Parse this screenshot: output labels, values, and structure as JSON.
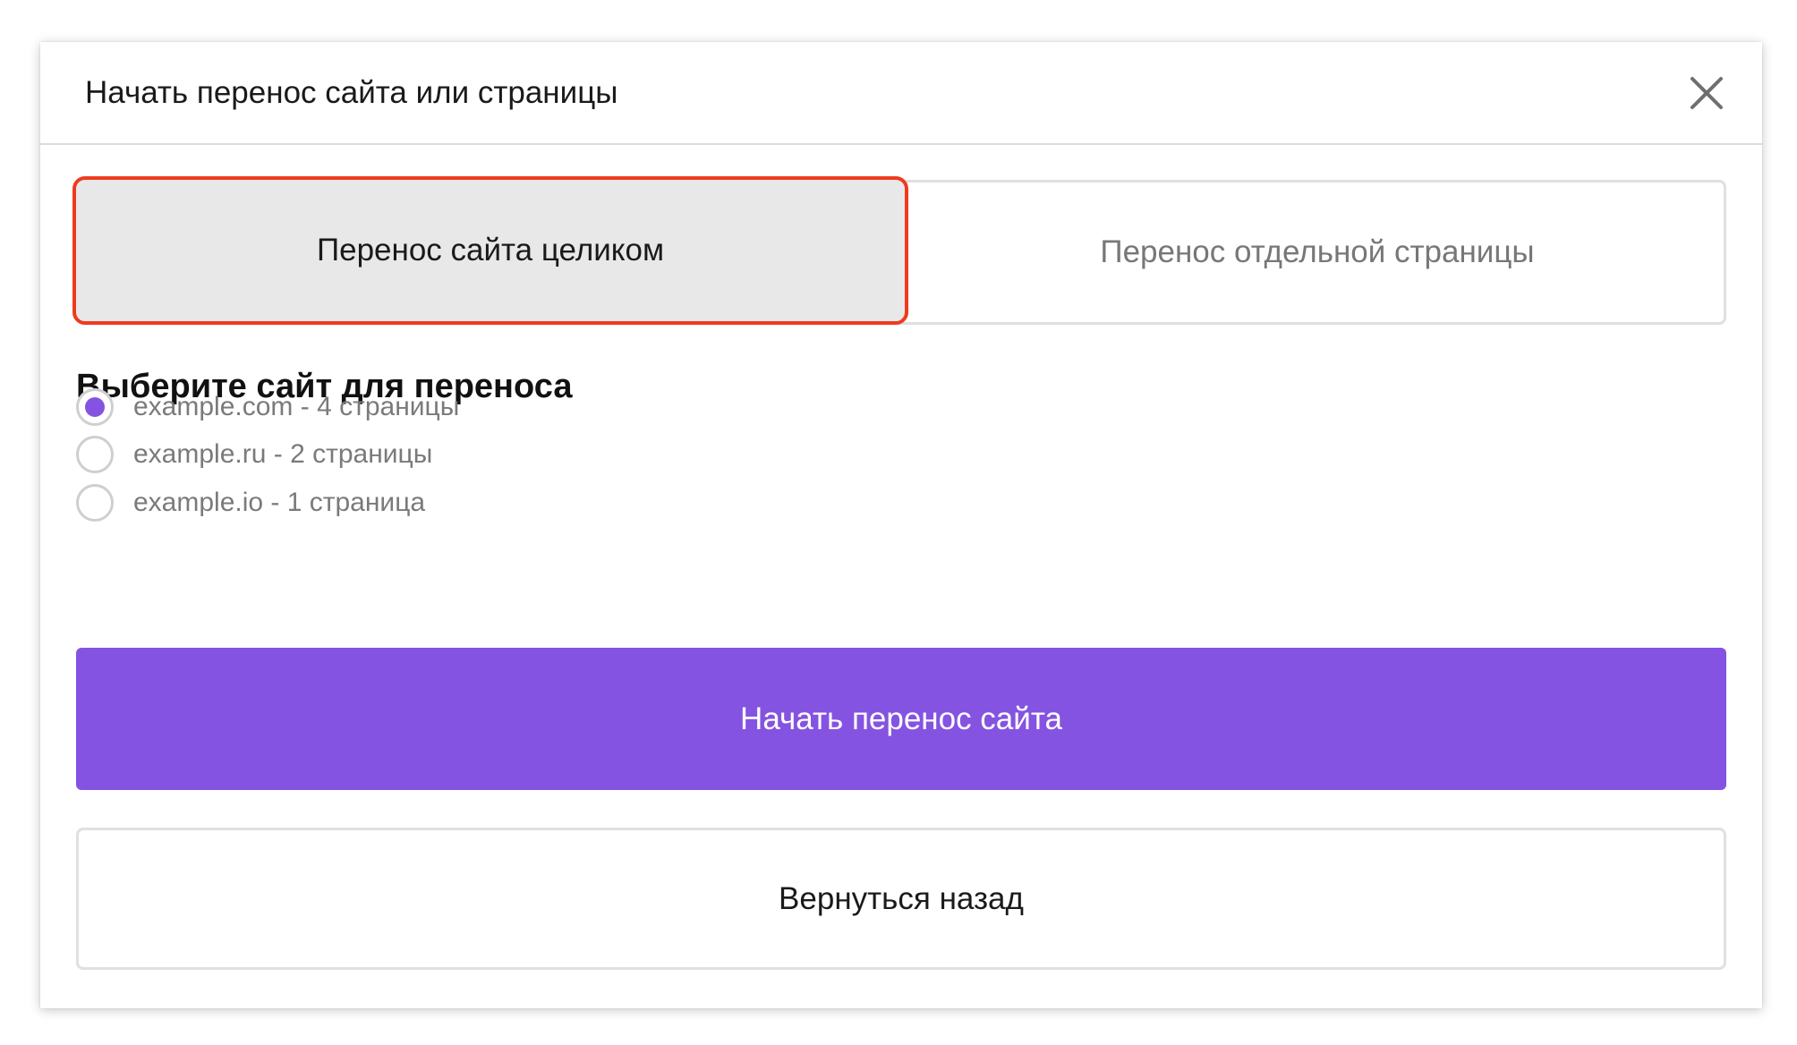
{
  "dialog": {
    "title": "Начать перенос сайта или страницы",
    "close_icon": "close-icon"
  },
  "tabs": [
    {
      "label": "Перенос сайта целиком",
      "active": true
    },
    {
      "label": "Перенос отдельной страницы",
      "active": false
    }
  ],
  "site_select": {
    "heading": "Выберите сайт для переноса",
    "options": [
      {
        "label": "example.com - 4 страницы",
        "checked": true
      },
      {
        "label": "example.ru - 2 страницы",
        "checked": false
      },
      {
        "label": "example.io - 1 страница",
        "checked": false
      }
    ]
  },
  "actions": {
    "start_label": "Начать перенос сайта",
    "back_label": "Вернуться назад"
  },
  "colors": {
    "accent": "#8553e1",
    "highlight_outline": "#f03a1e",
    "active_tab_bg": "#e8e8e8"
  }
}
